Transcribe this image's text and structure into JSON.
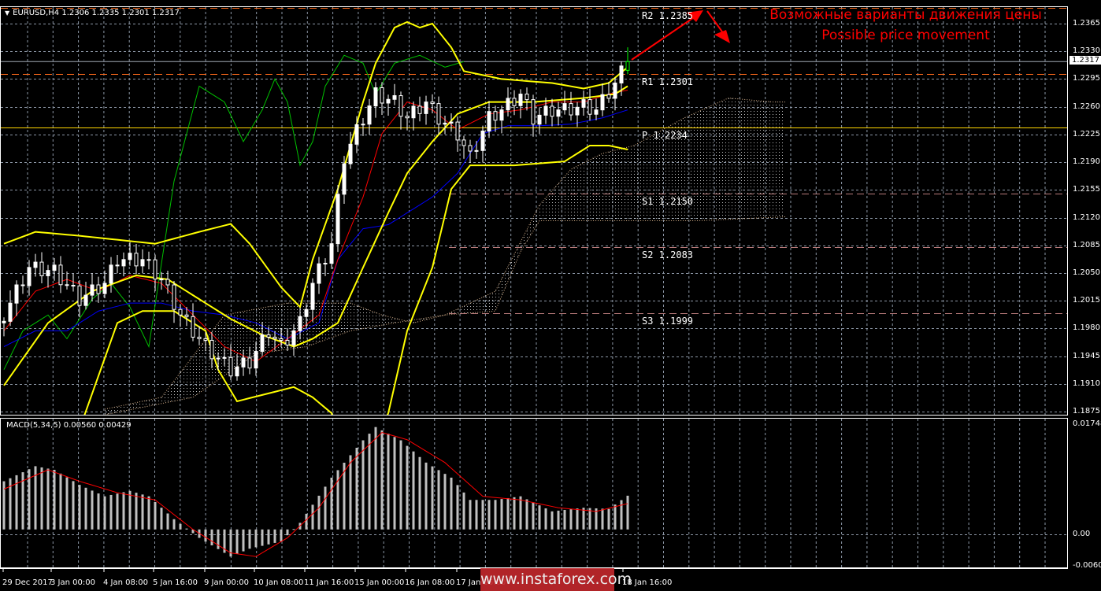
{
  "header": {
    "symbol_info": "EURUSD,H4  1.2306 1.2335 1.2301 1.2317",
    "macd_info": "MACD(5,34,5) 0.00560 0.00429"
  },
  "annotation": {
    "line1": "Возможные варианты движения цены",
    "line2": "Possible price movement"
  },
  "watermark": "www.instaforex.com",
  "current_price": "1.2317",
  "colors": {
    "bg": "#000000",
    "grid": "#8c97a6",
    "bollinger": "#ffff00",
    "tenkan": "#ff0000",
    "kijun": "#0000ff",
    "chikou": "#00c000",
    "cloud": "#d9b38c",
    "pivot_r": "#ff6a1a",
    "pivot_p": "#ffd700",
    "pivot_s": "#b87a7a",
    "macd_hist": "#c0c0c0",
    "macd_signal": "#ff0000",
    "arrow": "#ff0000"
  },
  "pivots": [
    {
      "label": "R2 1.2385",
      "value": 1.2385,
      "kind": "r"
    },
    {
      "label": "R1 1.2301",
      "value": 1.2301,
      "kind": "r"
    },
    {
      "label": "P 1.2234",
      "value": 1.2234,
      "kind": "p"
    },
    {
      "label": "S1 1.2150",
      "value": 1.215,
      "kind": "s"
    },
    {
      "label": "S2 1.2083",
      "value": 1.2083,
      "kind": "s"
    },
    {
      "label": "S3 1.1999",
      "value": 1.1999,
      "kind": "s"
    }
  ],
  "chart_data": {
    "type": "candlestick",
    "title": "EURUSD,H4",
    "price_axis": {
      "ylim": [
        1.1875,
        1.2365
      ],
      "ticks": [
        "1.2365",
        "1.2330",
        "1.2295",
        "1.2260",
        "1.2225",
        "1.2190",
        "1.2155",
        "1.2120",
        "1.2085",
        "1.2050",
        "1.2015",
        "1.1980",
        "1.1945",
        "1.1910",
        "1.1875"
      ]
    },
    "macd_axis": {
      "ylim": [
        -0.00604,
        0.01748
      ],
      "ticks": [
        "0.01748",
        "0.00",
        "-0.00604"
      ]
    },
    "time_ticks": [
      "29 Dec 2017",
      "3 Jan 00:00",
      "4 Jan 08:00",
      "5 Jan 16:00",
      "9 Jan 00:00",
      "10 Jan 08:00",
      "11 Jan 16:00",
      "15 Jan 00:00",
      "16 Jan 08:00",
      "17 Jan 16:00",
      "18 Jan 16:00"
    ],
    "bar_count": 100,
    "close_keypoints": [
      [
        0,
        1.1997
      ],
      [
        4,
        1.2057
      ],
      [
        8,
        1.2052
      ],
      [
        12,
        1.2017
      ],
      [
        16,
        1.2037
      ],
      [
        18,
        1.2067
      ],
      [
        22,
        1.2067
      ],
      [
        25,
        1.2042
      ],
      [
        28,
        1.1997
      ],
      [
        32,
        1.1957
      ],
      [
        36,
        1.1928
      ],
      [
        39,
        1.1938
      ],
      [
        42,
        1.1977
      ],
      [
        44,
        1.1957
      ],
      [
        47,
        1.1987
      ],
      [
        49,
        1.2037
      ],
      [
        52,
        1.2087
      ],
      [
        54,
        1.2196
      ],
      [
        57,
        1.2246
      ],
      [
        59,
        1.2276
      ],
      [
        62,
        1.2266
      ],
      [
        64,
        1.2246
      ],
      [
        67,
        1.2266
      ],
      [
        69,
        1.2246
      ],
      [
        72,
        1.2226
      ],
      [
        74,
        1.2196
      ],
      [
        77,
        1.2246
      ],
      [
        79,
        1.2256
      ],
      [
        82,
        1.2276
      ],
      [
        84,
        1.2246
      ],
      [
        87,
        1.2256
      ],
      [
        89,
        1.2256
      ],
      [
        92,
        1.2261
      ],
      [
        94,
        1.2256
      ],
      [
        97,
        1.229
      ],
      [
        99,
        1.2317
      ]
    ],
    "last_ohlc": {
      "open": 1.2306,
      "high": 1.2335,
      "low": 1.2301,
      "close": 1.2317
    },
    "bollinger_upper": [
      [
        0,
        1.2087
      ],
      [
        5,
        1.2102
      ],
      [
        12,
        1.2097
      ],
      [
        18,
        1.2092
      ],
      [
        24,
        1.2087
      ],
      [
        31,
        1.2102
      ],
      [
        36,
        1.2112
      ],
      [
        39,
        1.2087
      ],
      [
        44,
        1.2032
      ],
      [
        47,
        1.2007
      ],
      [
        49,
        1.2067
      ],
      [
        53,
        1.2156
      ],
      [
        57,
        1.2266
      ],
      [
        59,
        1.2315
      ],
      [
        62,
        1.236
      ],
      [
        64,
        1.2367
      ],
      [
        66,
        1.236
      ],
      [
        68,
        1.2365
      ],
      [
        71,
        1.2335
      ],
      [
        73,
        1.2305
      ],
      [
        79,
        1.2295
      ],
      [
        87,
        1.229
      ],
      [
        92,
        1.2283
      ],
      [
        96,
        1.229
      ],
      [
        99,
        1.231
      ]
    ],
    "bollinger_middle": [
      [
        0,
        1.1908
      ],
      [
        7,
        1.1987
      ],
      [
        14,
        1.2027
      ],
      [
        21,
        1.2047
      ],
      [
        26,
        1.2042
      ],
      [
        31,
        1.2017
      ],
      [
        36,
        1.1992
      ],
      [
        41,
        1.1972
      ],
      [
        46,
        1.1957
      ],
      [
        49,
        1.1967
      ],
      [
        53,
        1.1987
      ],
      [
        57,
        1.2057
      ],
      [
        61,
        1.2126
      ],
      [
        64,
        1.2176
      ],
      [
        68,
        1.2216
      ],
      [
        72,
        1.2251
      ],
      [
        77,
        1.2266
      ],
      [
        84,
        1.2266
      ],
      [
        92,
        1.2271
      ],
      [
        97,
        1.2276
      ],
      [
        99,
        1.2286
      ]
    ],
    "bollinger_lower": [
      [
        10,
        1.183
      ],
      [
        12,
        1.1853
      ],
      [
        18,
        1.1987
      ],
      [
        22,
        1.2002
      ],
      [
        27,
        1.2002
      ],
      [
        32,
        1.1977
      ],
      [
        34,
        1.1928
      ],
      [
        37,
        1.1888
      ],
      [
        42,
        1.1898
      ],
      [
        46,
        1.1906
      ],
      [
        49,
        1.1893
      ],
      [
        52,
        1.1873
      ],
      [
        56,
        1.178
      ],
      [
        61,
        1.1873
      ],
      [
        64,
        1.1977
      ],
      [
        68,
        1.2057
      ],
      [
        71,
        1.2156
      ],
      [
        74,
        1.2186
      ],
      [
        81,
        1.2186
      ],
      [
        89,
        1.2191
      ],
      [
        93,
        1.2211
      ],
      [
        96,
        1.2211
      ],
      [
        99,
        1.2206
      ]
    ],
    "tenkan": [
      [
        0,
        1.1977
      ],
      [
        5,
        1.2027
      ],
      [
        10,
        1.2042
      ],
      [
        15,
        1.2027
      ],
      [
        20,
        1.2047
      ],
      [
        25,
        1.2037
      ],
      [
        30,
        1.1997
      ],
      [
        35,
        1.1957
      ],
      [
        40,
        1.1938
      ],
      [
        45,
        1.1967
      ],
      [
        50,
        1.1997
      ],
      [
        53,
        1.2067
      ],
      [
        57,
        1.2146
      ],
      [
        60,
        1.2226
      ],
      [
        64,
        1.2266
      ],
      [
        68,
        1.2256
      ],
      [
        72,
        1.2231
      ],
      [
        77,
        1.2251
      ],
      [
        82,
        1.2256
      ],
      [
        87,
        1.2266
      ],
      [
        92,
        1.2266
      ],
      [
        96,
        1.2276
      ],
      [
        99,
        1.2281
      ]
    ],
    "kijun": [
      [
        0,
        1.1957
      ],
      [
        5,
        1.1977
      ],
      [
        10,
        1.1977
      ],
      [
        15,
        1.2002
      ],
      [
        20,
        1.2012
      ],
      [
        25,
        1.2012
      ],
      [
        30,
        1.2002
      ],
      [
        35,
        1.1997
      ],
      [
        40,
        1.1987
      ],
      [
        45,
        1.1967
      ],
      [
        50,
        1.1987
      ],
      [
        53,
        1.2067
      ],
      [
        57,
        1.2106
      ],
      [
        61,
        1.2111
      ],
      [
        64,
        1.2126
      ],
      [
        68,
        1.2146
      ],
      [
        72,
        1.2176
      ],
      [
        76,
        1.2226
      ],
      [
        80,
        1.2236
      ],
      [
        85,
        1.2236
      ],
      [
        90,
        1.2238
      ],
      [
        95,
        1.2246
      ],
      [
        99,
        1.2256
      ]
    ],
    "chikou": [
      [
        0,
        1.1928
      ],
      [
        3,
        1.1977
      ],
      [
        7,
        1.1997
      ],
      [
        10,
        1.1967
      ],
      [
        14,
        1.2017
      ],
      [
        17,
        1.2037
      ],
      [
        20,
        1.2007
      ],
      [
        23,
        1.1957
      ],
      [
        25,
        1.2062
      ],
      [
        27,
        1.2166
      ],
      [
        31,
        1.2286
      ],
      [
        35,
        1.2266
      ],
      [
        38,
        1.2216
      ],
      [
        41,
        1.2256
      ],
      [
        43,
        1.2295
      ],
      [
        45,
        1.2266
      ],
      [
        47,
        1.2186
      ],
      [
        49,
        1.2216
      ],
      [
        51,
        1.2286
      ],
      [
        54,
        1.2325
      ],
      [
        57,
        1.2315
      ],
      [
        59,
        1.2276
      ],
      [
        62,
        1.2315
      ],
      [
        66,
        1.2325
      ],
      [
        70,
        1.231
      ],
      [
        73,
        1.2317
      ]
    ],
    "senkou_a": [
      [
        16,
        1.1878
      ],
      [
        25,
        1.1893
      ],
      [
        35,
        1.1997
      ],
      [
        45,
        1.2012
      ],
      [
        55,
        1.2012
      ],
      [
        60,
        1.1997
      ],
      [
        65,
        1.1987
      ],
      [
        70,
        1.1997
      ],
      [
        78,
        1.2027
      ],
      [
        85,
        1.2136
      ],
      [
        90,
        1.2181
      ],
      [
        95,
        1.2201
      ],
      [
        100,
        1.2211
      ],
      [
        108,
        1.2246
      ],
      [
        115,
        1.2271
      ],
      [
        122,
        1.2266
      ],
      [
        124,
        1.2266
      ]
    ],
    "senkou_b": [
      [
        16,
        1.1871
      ],
      [
        30,
        1.1893
      ],
      [
        40,
        1.1948
      ],
      [
        48,
        1.1957
      ],
      [
        55,
        1.1977
      ],
      [
        62,
        1.1987
      ],
      [
        70,
        1.1997
      ],
      [
        78,
        1.2002
      ],
      [
        82,
        1.2077
      ],
      [
        85,
        1.2116
      ],
      [
        95,
        1.2116
      ],
      [
        110,
        1.2116
      ],
      [
        124,
        1.2121
      ]
    ],
    "macd_hist": [
      [
        0,
        0.008
      ],
      [
        5,
        0.0105
      ],
      [
        8,
        0.0099
      ],
      [
        12,
        0.0074
      ],
      [
        16,
        0.0055
      ],
      [
        20,
        0.0064
      ],
      [
        23,
        0.0055
      ],
      [
        27,
        0.0017
      ],
      [
        31,
        -0.0014
      ],
      [
        36,
        -0.0045
      ],
      [
        39,
        -0.0032
      ],
      [
        44,
        -0.002
      ],
      [
        47,
        0.0011
      ],
      [
        52,
        0.0086
      ],
      [
        57,
        0.0148
      ],
      [
        59,
        0.017
      ],
      [
        63,
        0.0148
      ],
      [
        67,
        0.0111
      ],
      [
        71,
        0.0086
      ],
      [
        74,
        0.0049
      ],
      [
        78,
        0.0049
      ],
      [
        82,
        0.0055
      ],
      [
        87,
        0.003
      ],
      [
        92,
        0.0036
      ],
      [
        96,
        0.0034
      ],
      [
        99,
        0.0056
      ]
    ],
    "macd_signal": [
      [
        0,
        0.0067
      ],
      [
        7,
        0.0099
      ],
      [
        12,
        0.008
      ],
      [
        18,
        0.0061
      ],
      [
        24,
        0.0049
      ],
      [
        30,
        0.0
      ],
      [
        36,
        -0.0039
      ],
      [
        40,
        -0.0045
      ],
      [
        45,
        -0.0014
      ],
      [
        50,
        0.0036
      ],
      [
        55,
        0.0111
      ],
      [
        60,
        0.0161
      ],
      [
        64,
        0.0149
      ],
      [
        70,
        0.0111
      ],
      [
        76,
        0.0055
      ],
      [
        82,
        0.0049
      ],
      [
        88,
        0.0036
      ],
      [
        94,
        0.003
      ],
      [
        99,
        0.00429
      ]
    ]
  }
}
